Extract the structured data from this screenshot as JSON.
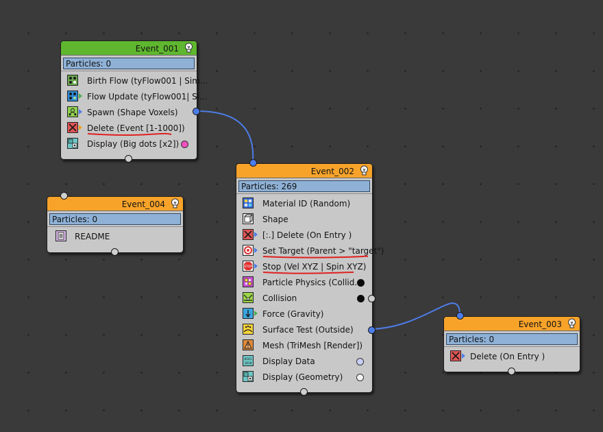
{
  "colors": {
    "green_header": "#5fb72f",
    "orange_header": "#f7a32a",
    "particles_bar": "#8fb1d6",
    "wire": "#4d7de8",
    "annotation": "#e02020",
    "display_dot_pink": "#f050c0",
    "collision_dot": "#0a0a0a",
    "display_data_dot": "#c8cff5",
    "display_geometry_dot": "#f2f2f2"
  },
  "nodes": {
    "event_001": {
      "title": "Event_001",
      "particles": "Particles: 0",
      "ops": [
        {
          "label": "Birth Flow (tyFlow001 | Sim...",
          "icon": "birth-flow-icon"
        },
        {
          "label": "Flow Update (tyFlow001| Si...",
          "icon": "flow-update-icon"
        },
        {
          "label": "Spawn (Shape Voxels)",
          "icon": "spawn-icon"
        },
        {
          "label": "Delete (Event [1-1000])",
          "icon": "delete-icon"
        },
        {
          "label": "Display (Big dots [x2])",
          "icon": "display-icon"
        }
      ]
    },
    "event_002": {
      "title": "Event_002",
      "particles": "Particles: 269",
      "ops": [
        {
          "label": "Material ID (Random)",
          "icon": "material-id-icon"
        },
        {
          "label": "Shape",
          "icon": "shape-icon"
        },
        {
          "label": "[:.] Delete (On Entry )",
          "icon": "delete-icon"
        },
        {
          "label": "Set Target (Parent > \"target\")",
          "icon": "set-target-icon"
        },
        {
          "label": "Stop (Vel XYZ | Spin XYZ)",
          "icon": "stop-icon"
        },
        {
          "label": "Particle Physics (Collid...",
          "icon": "particle-physics-icon"
        },
        {
          "label": "Collision",
          "icon": "collision-icon"
        },
        {
          "label": "Force (Gravity)",
          "icon": "force-icon"
        },
        {
          "label": "Surface Test (Outside)",
          "icon": "surface-test-icon"
        },
        {
          "label": "Mesh (TriMesh [Render])",
          "icon": "mesh-icon"
        },
        {
          "label": "Display Data",
          "icon": "display-data-icon"
        },
        {
          "label": "Display (Geometry)",
          "icon": "display-icon"
        }
      ]
    },
    "event_003": {
      "title": "Event_003",
      "particles": "Particles: 0",
      "ops": [
        {
          "label": "Delete (On Entry )",
          "icon": "delete-icon"
        }
      ]
    },
    "event_004": {
      "title": "Event_004",
      "particles": "Particles: 0",
      "ops": [
        {
          "label": "README",
          "icon": "readme-icon"
        }
      ]
    }
  }
}
